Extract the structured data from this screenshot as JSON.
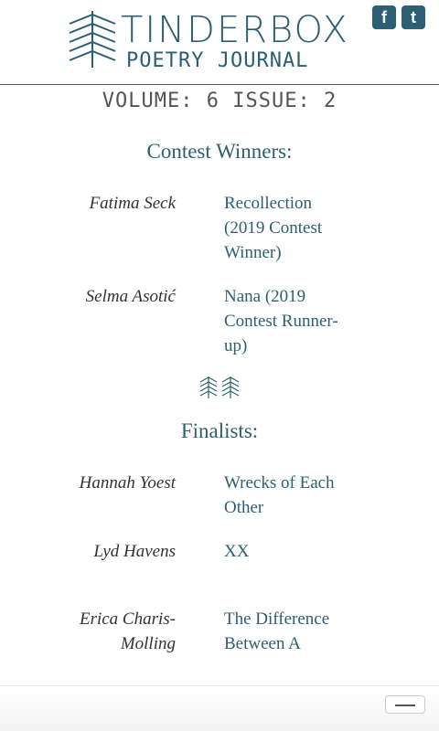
{
  "header": {
    "logo_title": "TINDERBOX",
    "logo_subtitle": "POETRY JOURNAL",
    "social": [
      {
        "icon": "facebook-icon",
        "glyph": "f"
      },
      {
        "icon": "twitter-icon",
        "glyph": "t"
      }
    ]
  },
  "issue": "VOLUME: 6 ISSUE: 2",
  "contest": {
    "title": "Contest Winners:",
    "entries": [
      {
        "author": "Fatima Seck",
        "poem": "Recollection (2019 Contest Winner)"
      },
      {
        "author": "Selma Asotić",
        "poem": "Nana (2019 Contest Runner-up)"
      }
    ]
  },
  "finalists": {
    "title": "Finalists:",
    "entries": [
      {
        "author": "Hannah Yoest",
        "poem": "Wrecks of Each Other"
      },
      {
        "author": "Lyd Havens",
        "poem": "XX"
      },
      {
        "author": "Erica Charis-Molling",
        "poem": "The Difference Between A"
      }
    ]
  },
  "colors": {
    "accent": "#2c5f73",
    "text": "#333333"
  },
  "menu": {
    "icon": "hamburger-icon"
  }
}
